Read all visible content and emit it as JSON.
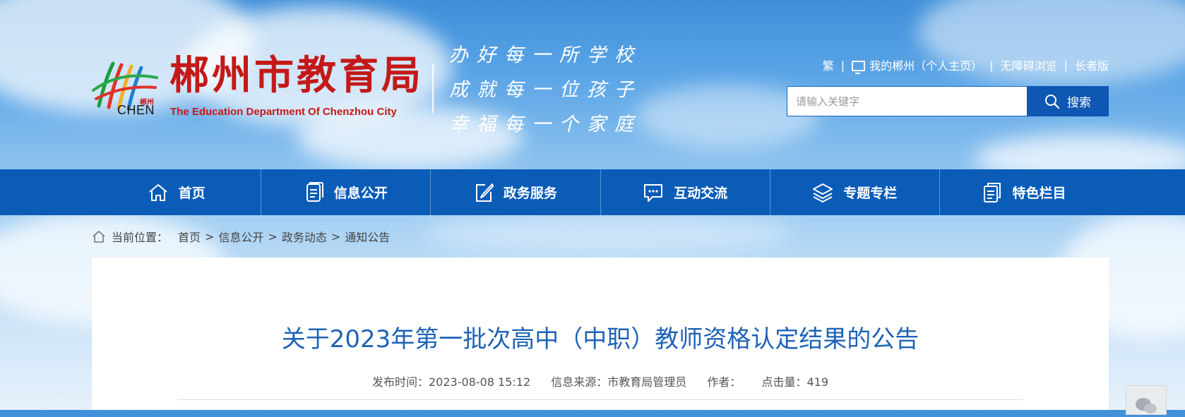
{
  "header": {
    "title": "郴州市教育局",
    "subtitle": "The Education Department Of Chenzhou City",
    "logo_small": "郴州",
    "logo_text": "CHEN",
    "slogan": [
      "办好每一所学校",
      "成就每一位孩子",
      "幸福每一个家庭"
    ],
    "links": {
      "traditional": "繁",
      "my_chenzhou": "我的郴州（个人主页）",
      "accessible": "无障碍浏览",
      "elderly": "长者版"
    },
    "search": {
      "placeholder": "请输入关键字",
      "button": "搜索"
    }
  },
  "nav": [
    {
      "label": "首页",
      "icon": "home-icon"
    },
    {
      "label": "信息公开",
      "icon": "document-icon"
    },
    {
      "label": "政务服务",
      "icon": "edit-icon"
    },
    {
      "label": "互动交流",
      "icon": "chat-icon"
    },
    {
      "label": "专题专栏",
      "icon": "layers-icon"
    },
    {
      "label": "特色栏目",
      "icon": "clipboard-icon"
    }
  ],
  "breadcrumb": {
    "prefix": "当前位置：",
    "items": [
      "首页",
      "信息公开",
      "政务动态",
      "通知公告"
    ],
    "separator": ">"
  },
  "article": {
    "title": "关于2023年第一批次高中（中职）教师资格认定结果的公告",
    "publish_time": "发布时间：2023-08-08 15:12",
    "source": "信息来源：市教育局管理员",
    "author": "作者：",
    "clicks": "点击量：419"
  },
  "colors": {
    "accent": "#0a5cb7",
    "title_red": "#c41919",
    "article_title": "#1f63b6"
  }
}
